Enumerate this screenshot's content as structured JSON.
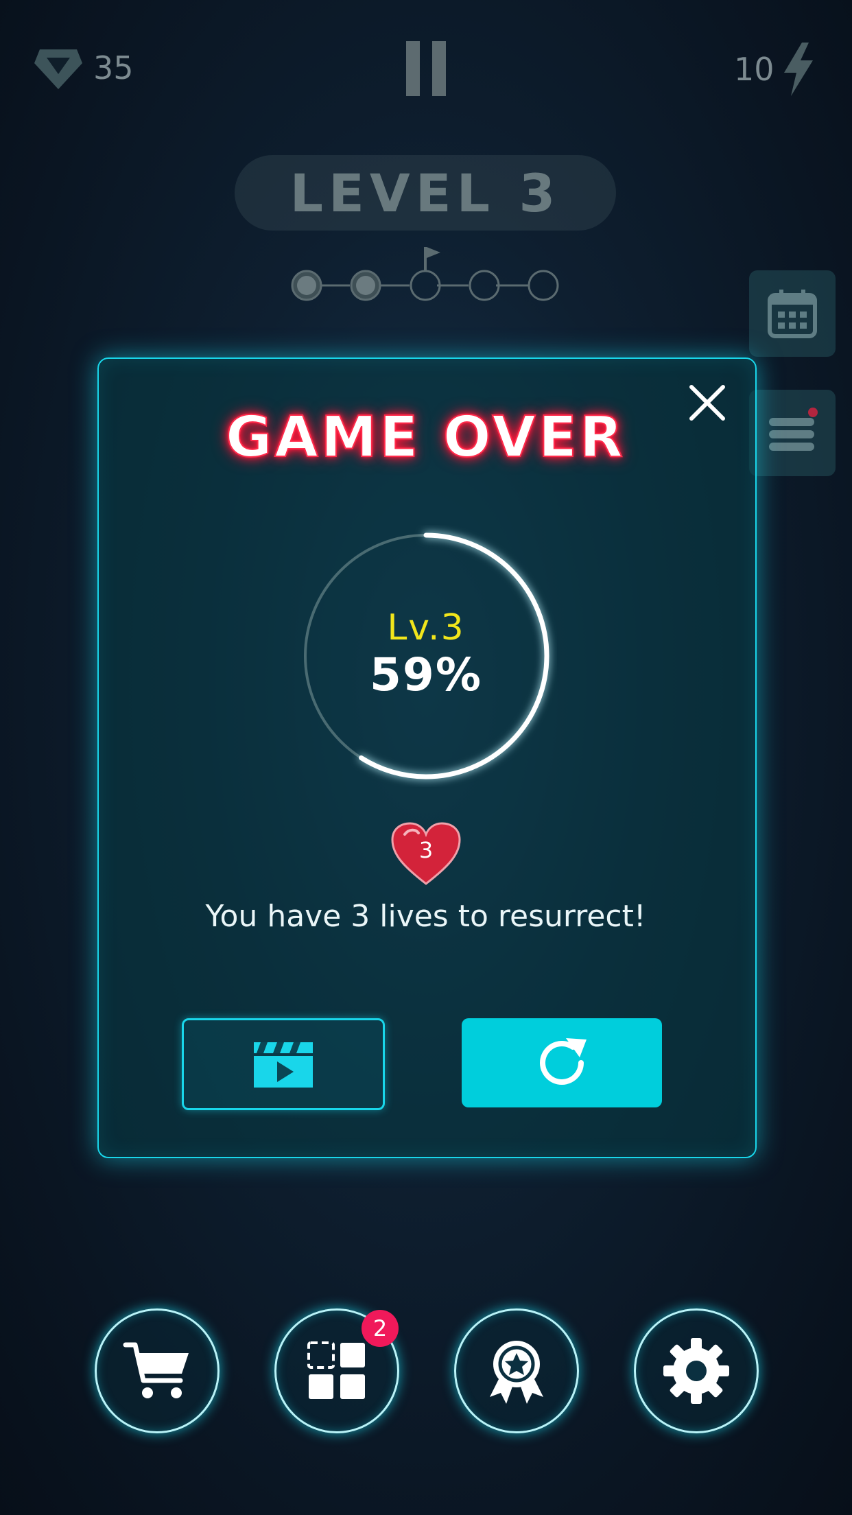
{
  "topbar": {
    "gems": "35",
    "energy": "10",
    "gem_icon": "diamond-icon",
    "energy_icon": "lightning-icon",
    "pause_icon": "pause-icon"
  },
  "level_header": {
    "label": "LEVEL 3",
    "progress_steps_total": 5,
    "progress_steps_completed": 2,
    "flag_icon": "flag-icon"
  },
  "side_buttons": [
    "calendar-icon",
    "list-icon"
  ],
  "modal": {
    "title": "GAME OVER",
    "level": "Lv.3",
    "percent": "59%",
    "progress_fraction": 0.59,
    "lives_count": "3",
    "lives_message": "You have 3 lives to resurrect!",
    "video_button_icon": "video-clapper-icon",
    "retry_button_icon": "retry-icon",
    "close_icon": "close-icon"
  },
  "bottom_nav": {
    "items": [
      "cart-icon",
      "skins-icon",
      "achievement-icon",
      "settings-icon"
    ],
    "skins_badge": "2"
  },
  "colors": {
    "accent": "#19d6ea",
    "title_glow": "#ff1a3d",
    "level_yellow": "#f2e61b",
    "badge": "#f0195a",
    "heart": "#d3233a"
  }
}
